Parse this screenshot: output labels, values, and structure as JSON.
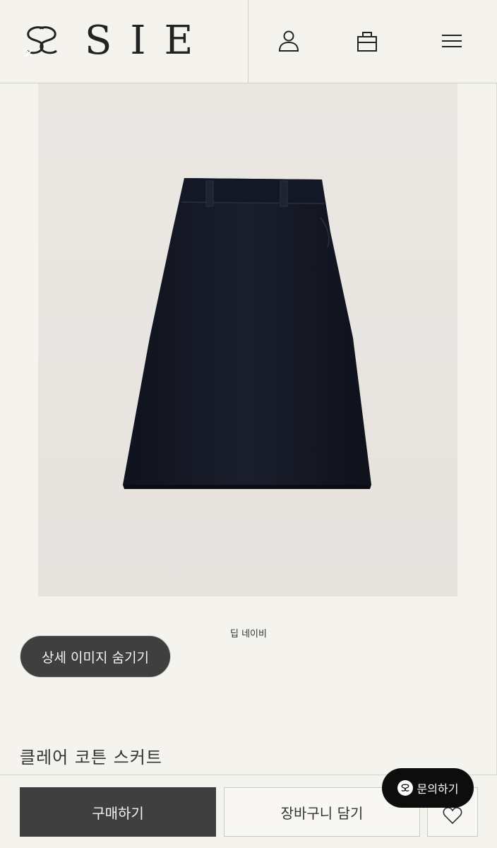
{
  "header": {
    "brand": "SIE",
    "icons": [
      "logo-mark",
      "user-icon",
      "bag-icon",
      "menu-icon"
    ]
  },
  "product": {
    "color_name": "딥 네이비",
    "detail_toggle_label": "상세 이미지 숨기기",
    "title": "클레어 코튼 스커트"
  },
  "actions": {
    "buy_label": "구매하기",
    "cart_label": "장바구니 담기",
    "inquiry_label": "문의하기"
  },
  "colors": {
    "background": "#f4f3ee",
    "dark_button": "#3f3f3f",
    "skirt": "#141826",
    "inquiry_bg": "#0d0d0d"
  }
}
